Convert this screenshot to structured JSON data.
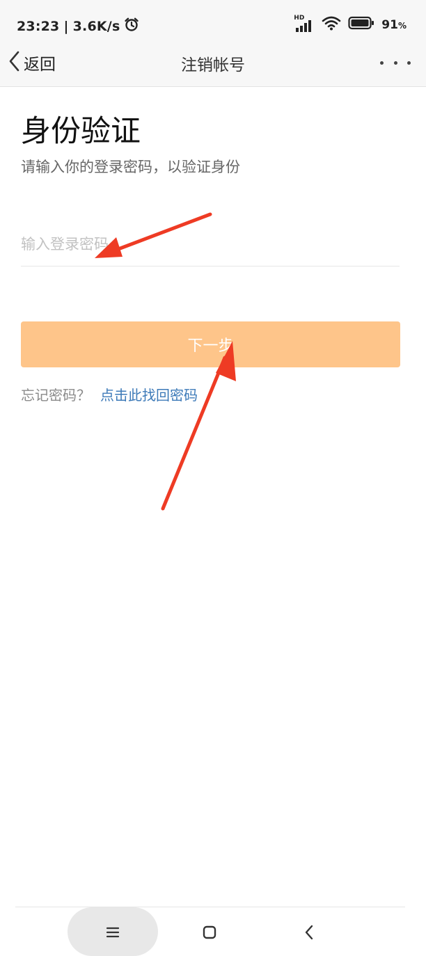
{
  "status_bar": {
    "time": "23:23",
    "separator": "|",
    "net_speed": "3.6K/s",
    "signal_label": "HD",
    "battery": "91",
    "battery_unit": "%",
    "icons": [
      "alarm-icon",
      "signal-icon",
      "wifi-icon",
      "battery-icon"
    ]
  },
  "nav": {
    "back_label": "返回",
    "title": "注销帐号",
    "icons": [
      "chevron-left-icon",
      "more-icon"
    ]
  },
  "main": {
    "heading": "身份验证",
    "subtitle": "请输入你的登录密码，以验证身份",
    "password_placeholder": "输入登录密码",
    "password_value": "",
    "next_label": "下一步",
    "next_color": "#fec58a",
    "forgot_prefix": "忘记密码？",
    "forgot_link": "点击此找回密码",
    "link_color": "#3d7ab8"
  },
  "annotation": {
    "arrow_color": "#ee3b24",
    "arrows": [
      "arrow-to-password",
      "arrow-to-next"
    ]
  },
  "system_nav": {
    "icons": [
      "menu-icon",
      "home-icon",
      "back-icon"
    ]
  }
}
